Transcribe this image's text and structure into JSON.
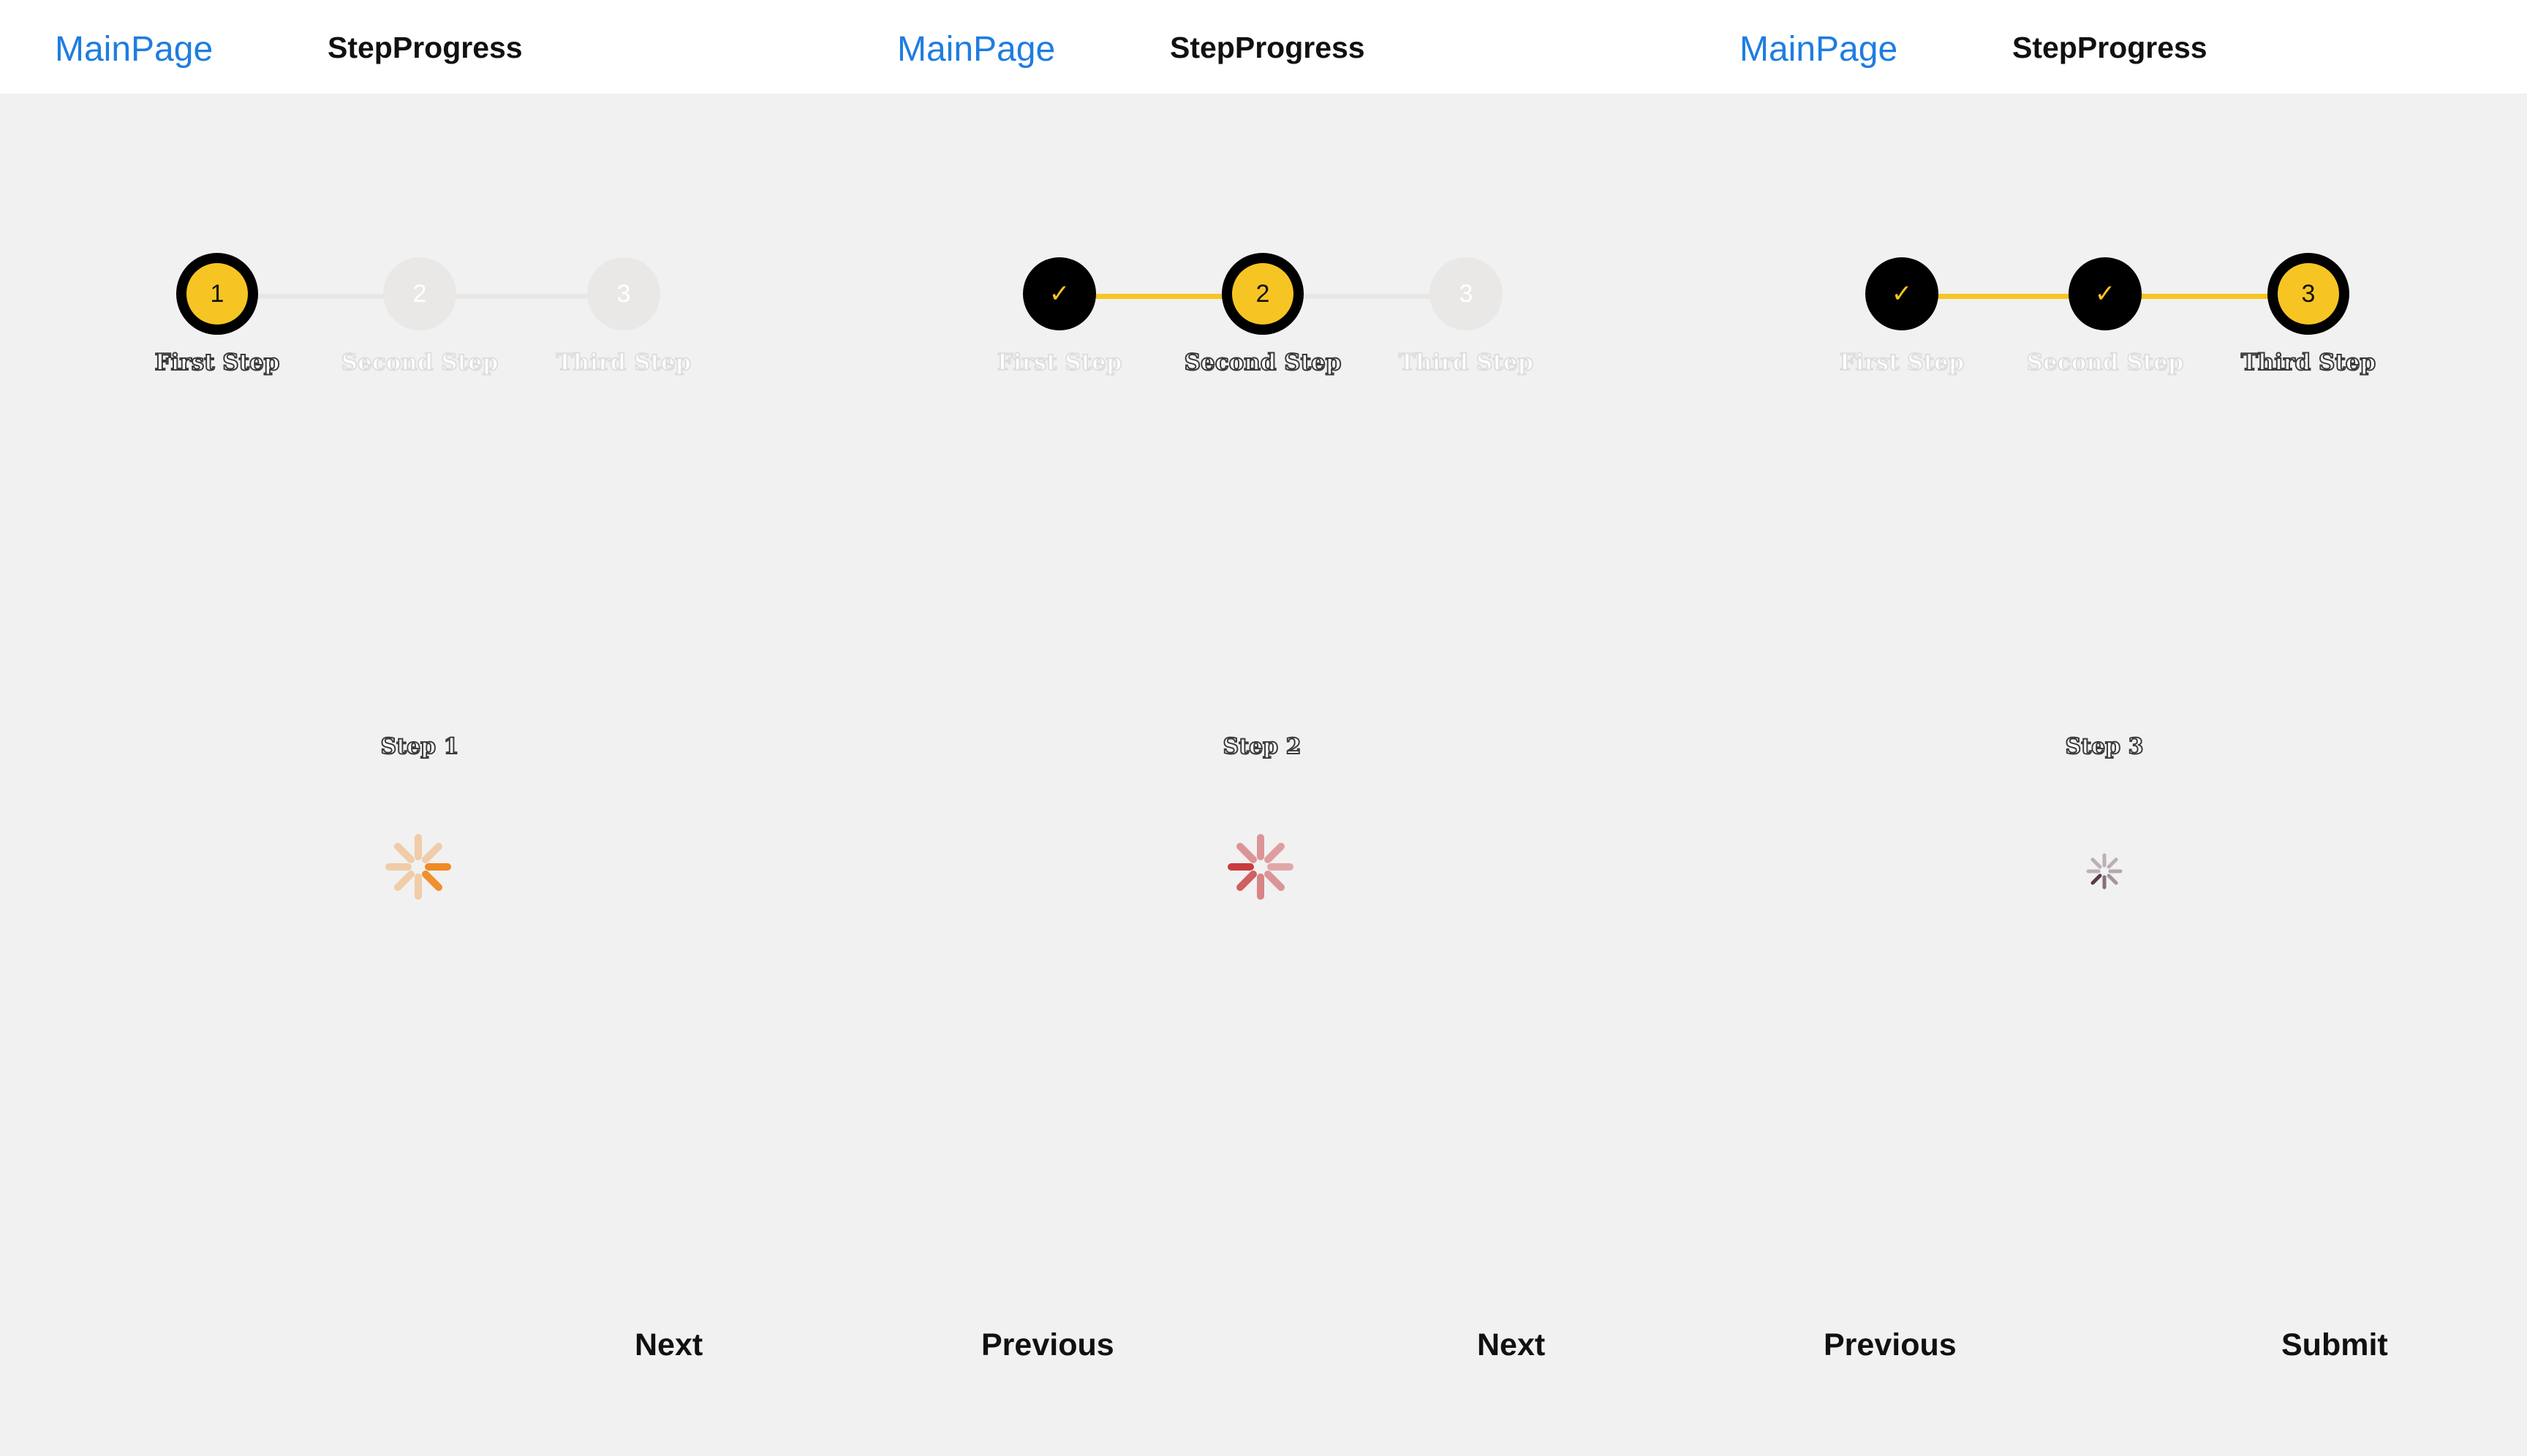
{
  "colors": {
    "nav_link": "#1e7de0",
    "accent": "#f7c523",
    "completed_circle": "#000000",
    "pending_circle": "#e9e8e6",
    "background": "#f1f1f1",
    "spinner_panel_1": "#f08a24",
    "spinner_panel_2": "#c93b3e",
    "spinner_panel_3": "#5a3a4a"
  },
  "panels": [
    {
      "nav": {
        "back_label": "MainPage",
        "title": "StepProgress"
      },
      "steps": [
        {
          "marker": "1",
          "label": "First Step",
          "state": "active"
        },
        {
          "marker": "2",
          "label": "Second Step",
          "state": "pending"
        },
        {
          "marker": "3",
          "label": "Third Step",
          "state": "pending"
        }
      ],
      "content": {
        "caption": "Step 1",
        "spinner_icon": "loading-spinner-icon"
      },
      "footer": {
        "right_label": "Next"
      }
    },
    {
      "nav": {
        "back_label": "MainPage",
        "title": "StepProgress"
      },
      "steps": [
        {
          "marker": "✓",
          "label": "First Step",
          "state": "completed"
        },
        {
          "marker": "2",
          "label": "Second Step",
          "state": "active"
        },
        {
          "marker": "3",
          "label": "Third Step",
          "state": "pending"
        }
      ],
      "content": {
        "caption": "Step 2",
        "spinner_icon": "loading-spinner-icon"
      },
      "footer": {
        "left_label": "Previous",
        "right_label": "Next"
      }
    },
    {
      "nav": {
        "back_label": "MainPage",
        "title": "StepProgress"
      },
      "steps": [
        {
          "marker": "✓",
          "label": "First Step",
          "state": "completed"
        },
        {
          "marker": "✓",
          "label": "Second Step",
          "state": "completed"
        },
        {
          "marker": "3",
          "label": "Third Step",
          "state": "active"
        }
      ],
      "content": {
        "caption": "Step 3",
        "spinner_icon": "loading-spinner-icon"
      },
      "footer": {
        "left_label": "Previous",
        "right_label": "Submit"
      }
    }
  ]
}
